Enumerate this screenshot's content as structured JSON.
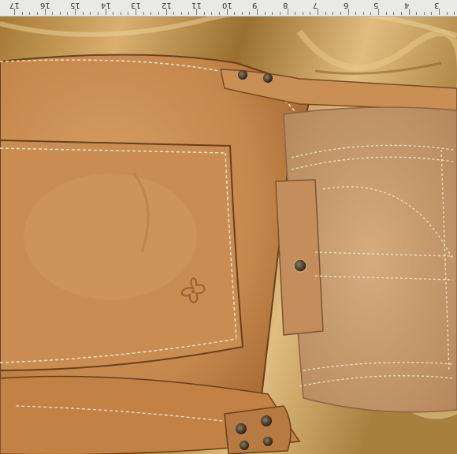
{
  "ruler": {
    "numbers": [
      "17",
      "16",
      "15",
      "14",
      "13",
      "12",
      "11",
      "10",
      "9",
      "8",
      "7",
      "6",
      "5",
      "4",
      "3"
    ]
  },
  "photo": {
    "subject_colors": {
      "leather": "#c4874c",
      "leather_dark": "#9c5f2a",
      "suede": "#c79b70",
      "satin": "#b88e45",
      "stitching": "#f2e2c4",
      "rivet": "#3a3026"
    },
    "embossed_logo_icon": "four-leaf-clover-icon"
  }
}
